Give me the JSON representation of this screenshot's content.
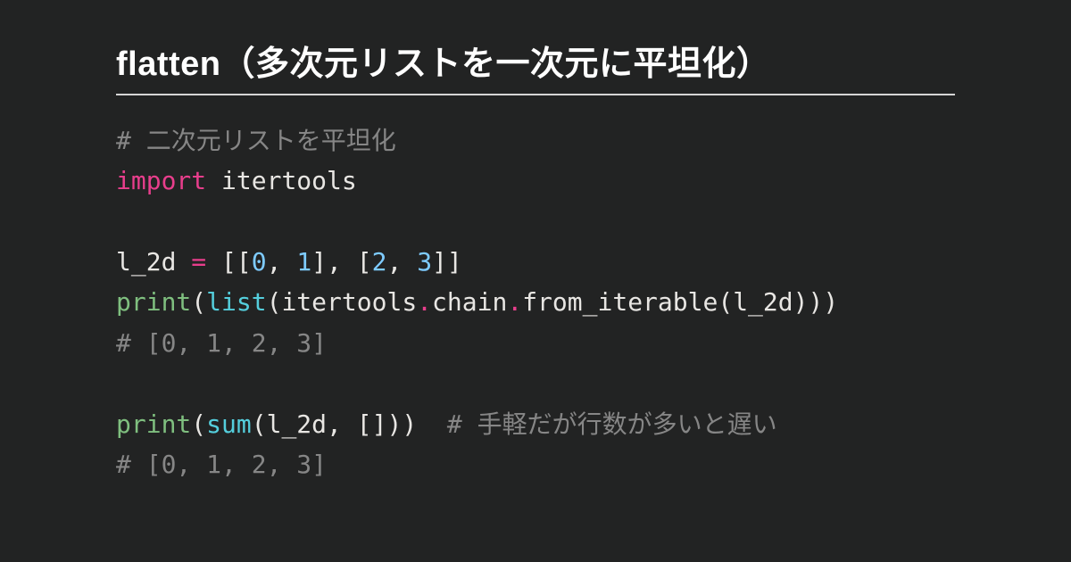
{
  "title": "flatten（多次元リストを一次元に平坦化）",
  "code": {
    "c1": "# 二次元リストを平坦化",
    "kw_import": "import",
    "module": "itertools",
    "var": "l_2d",
    "eq": " = ",
    "lbr1": "[[",
    "n0": "0",
    "comma_sp": ", ",
    "n1": "1",
    "rbr_c": "], [",
    "n2": "2",
    "n3": "3",
    "rbr2": "]]",
    "print": "print",
    "lp": "(",
    "rp": ")",
    "list": "list",
    "sum": "sum",
    "dot": ".",
    "chain": "chain",
    "from_iterable": "from_iterable",
    "out1": "# [0, 1, 2, 3]",
    "arg_var": "l_2d",
    "sum_sep": ", []",
    "rp2": "))",
    "rp3": ")))",
    "pad": "  ",
    "c2": "# 手軽だが行数が多いと遅い",
    "out2": "# [0, 1, 2, 3]"
  }
}
